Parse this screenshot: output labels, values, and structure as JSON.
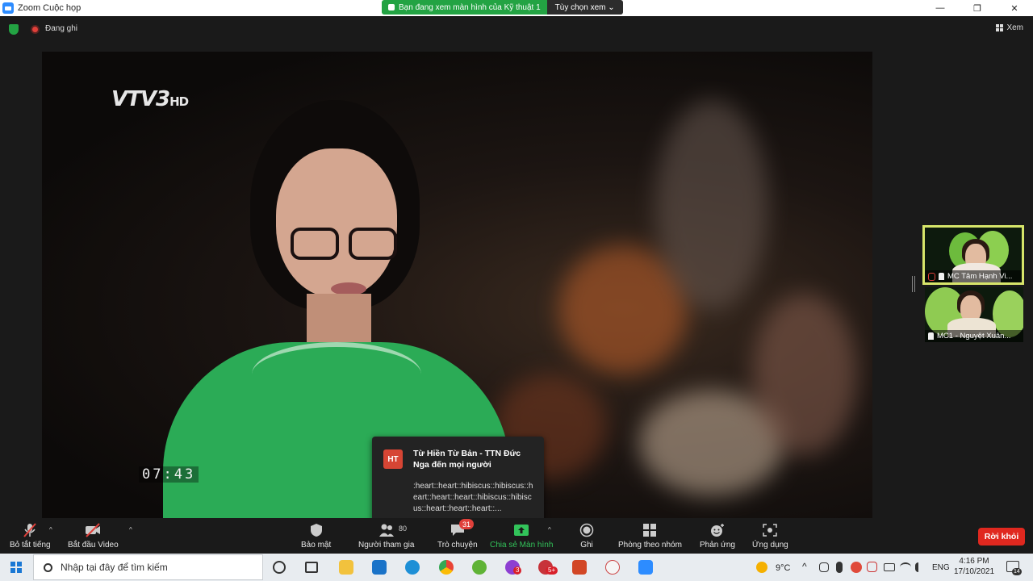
{
  "window": {
    "title": "Zoom Cuộc họp",
    "minimize": "—",
    "maximize": "❐",
    "close": "✕"
  },
  "share_banner": {
    "viewing_text": "Bạn đang xem màn hình của Kỹ thuật 1",
    "options_label": "Tùy chọn xem ⌄"
  },
  "status": {
    "recording_label": "Đang ghi",
    "view_label": "Xem"
  },
  "video": {
    "channel_logo": "VTV3",
    "channel_suffix": "HD",
    "timer": "07:43"
  },
  "thumbnails": [
    {
      "name": "MC Tâm Hạnh Vi...",
      "muted": true,
      "pinned": true,
      "active": true
    },
    {
      "name": "MC1 - Nguyệt Xuân...",
      "muted": false,
      "pinned": true,
      "active": false
    }
  ],
  "chat_notification": {
    "avatar_initials": "HT",
    "from": "Từ Hiền Từ Bản - TTN Đức Nga đến mọi người",
    "message": ":heart::heart::hibiscus::hibiscus::heart::heart::heart::hibiscus::hibiscus::heart::heart::heart::..."
  },
  "toolbar": {
    "mute_label": "Bỏ tắt tiếng",
    "video_label": "Bắt đầu Video",
    "security_label": "Bảo mật",
    "participants_label": "Người tham gia",
    "participants_count": "80",
    "chat_label": "Trò chuyện",
    "chat_badge": "31",
    "share_label": "Chia sẻ Màn hình",
    "record_label": "Ghi",
    "breakout_label": "Phòng theo nhóm",
    "reactions_label": "Phản ứng",
    "apps_label": "Ứng dụng",
    "leave_label": "Rời khỏi"
  },
  "taskbar": {
    "search_placeholder": "Nhập tại đây để tìm kiếm",
    "mail_badge": "3",
    "chat_badge": "5+",
    "weather": "9°C",
    "language": "ENG",
    "time": "4:16 PM",
    "date": "17/10/2021",
    "notification_count": "14"
  },
  "colors": {
    "zoom_blue": "#2d8cff",
    "share_green": "#23a343",
    "leave_red": "#e0281f",
    "active_speaker": "#d7e56a"
  }
}
